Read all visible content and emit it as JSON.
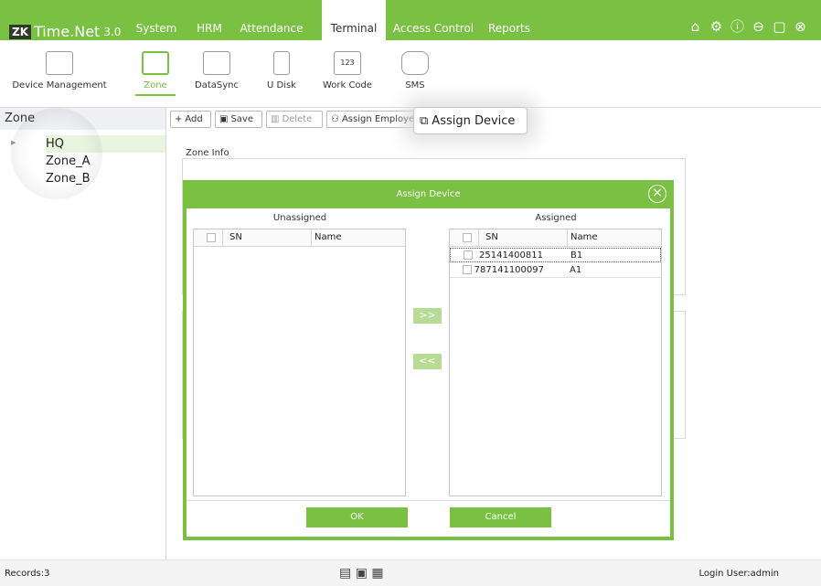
{
  "app": {
    "logo_mark": "ZK",
    "name": "Time.Net",
    "version": "3.0"
  },
  "menu": [
    {
      "label": "System"
    },
    {
      "label": "HRM"
    },
    {
      "label": "Attendance"
    },
    {
      "label": "Terminal"
    },
    {
      "label": "Access Control"
    },
    {
      "label": "Reports"
    }
  ],
  "window_icons": [
    "home-icon",
    "settings-icon",
    "help-icon",
    "minimize-icon",
    "maximize-icon",
    "close-icon"
  ],
  "submenu": [
    {
      "label": "Device Management"
    },
    {
      "label": "Zone"
    },
    {
      "label": "DataSync"
    },
    {
      "label": "U Disk"
    },
    {
      "label": "Work Code",
      "icon_text": "123"
    },
    {
      "label": "SMS"
    }
  ],
  "left_panel": {
    "header": "Zone",
    "tree": [
      "HQ",
      "Zone_A",
      "Zone_B"
    ]
  },
  "toolbar": {
    "add": "Add",
    "save": "Save",
    "delete": "Delete",
    "assign_employee": "Assign Employee",
    "assign_device": "Assign Device"
  },
  "main": {
    "zone_info_label": "Zone Info"
  },
  "dialog": {
    "title": "Assign Device",
    "unassigned_label": "Unassigned",
    "assigned_label": "Assigned",
    "col_sn": "SN",
    "col_name": "Name",
    "move_right": ">>",
    "move_left": "<<",
    "assigned_rows": [
      {
        "sn": "25141400811",
        "name": "B1"
      },
      {
        "sn": "787141100097",
        "name": "A1"
      }
    ],
    "ok": "OK",
    "cancel": "Cancel"
  },
  "status": {
    "records": "Records:3",
    "login_user": "Login User:admin"
  },
  "colors": {
    "accent": "#7ac143",
    "accent_light": "#b6db94"
  }
}
